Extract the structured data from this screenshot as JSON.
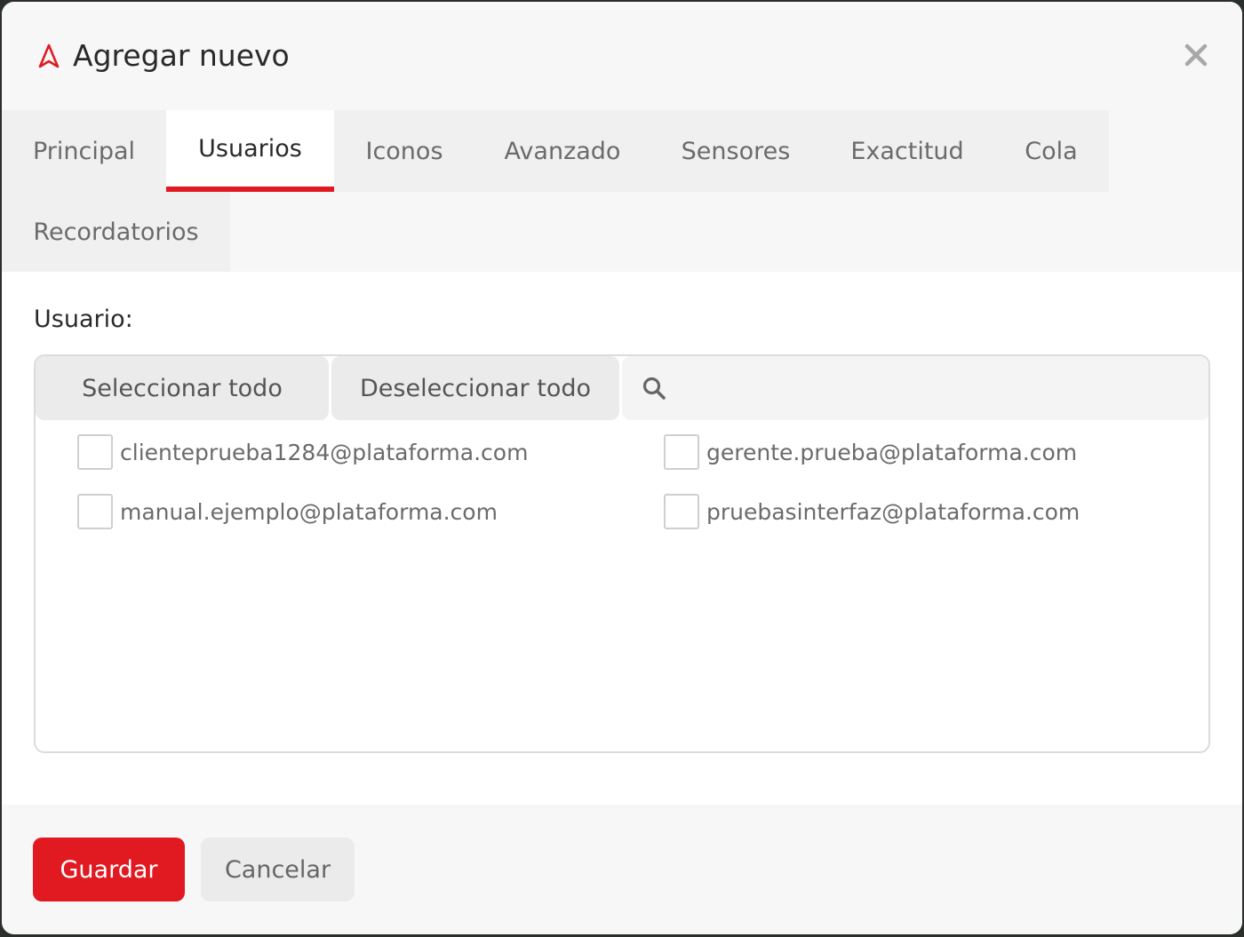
{
  "modal": {
    "title": "Agregar nuevo",
    "logo_icon": "navigation-arrow-icon",
    "close_icon": "close-icon"
  },
  "tabs": [
    {
      "label": "Principal",
      "active": false
    },
    {
      "label": "Usuarios",
      "active": true
    },
    {
      "label": "Iconos",
      "active": false
    },
    {
      "label": "Avanzado",
      "active": false
    },
    {
      "label": "Sensores",
      "active": false
    },
    {
      "label": "Exactitud",
      "active": false
    },
    {
      "label": "Cola",
      "active": false
    },
    {
      "label": "Recordatorios",
      "active": false
    }
  ],
  "users_panel": {
    "label": "Usuario:",
    "select_all_label": "Seleccionar todo",
    "deselect_all_label": "Deseleccionar todo",
    "search_placeholder": "",
    "search_value": "",
    "users": [
      {
        "email": "clienteprueba1284@plataforma.com",
        "checked": false
      },
      {
        "email": "gerente.prueba@plataforma.com",
        "checked": false
      },
      {
        "email": "manual.ejemplo@plataforma.com",
        "checked": false
      },
      {
        "email": "pruebasinterfaz@plataforma.com",
        "checked": false
      }
    ]
  },
  "footer": {
    "save_label": "Guardar",
    "cancel_label": "Cancelar"
  },
  "colors": {
    "accent": "#e11a22",
    "tab_bg": "#f0f0f0",
    "button_bg": "#ebebeb"
  }
}
